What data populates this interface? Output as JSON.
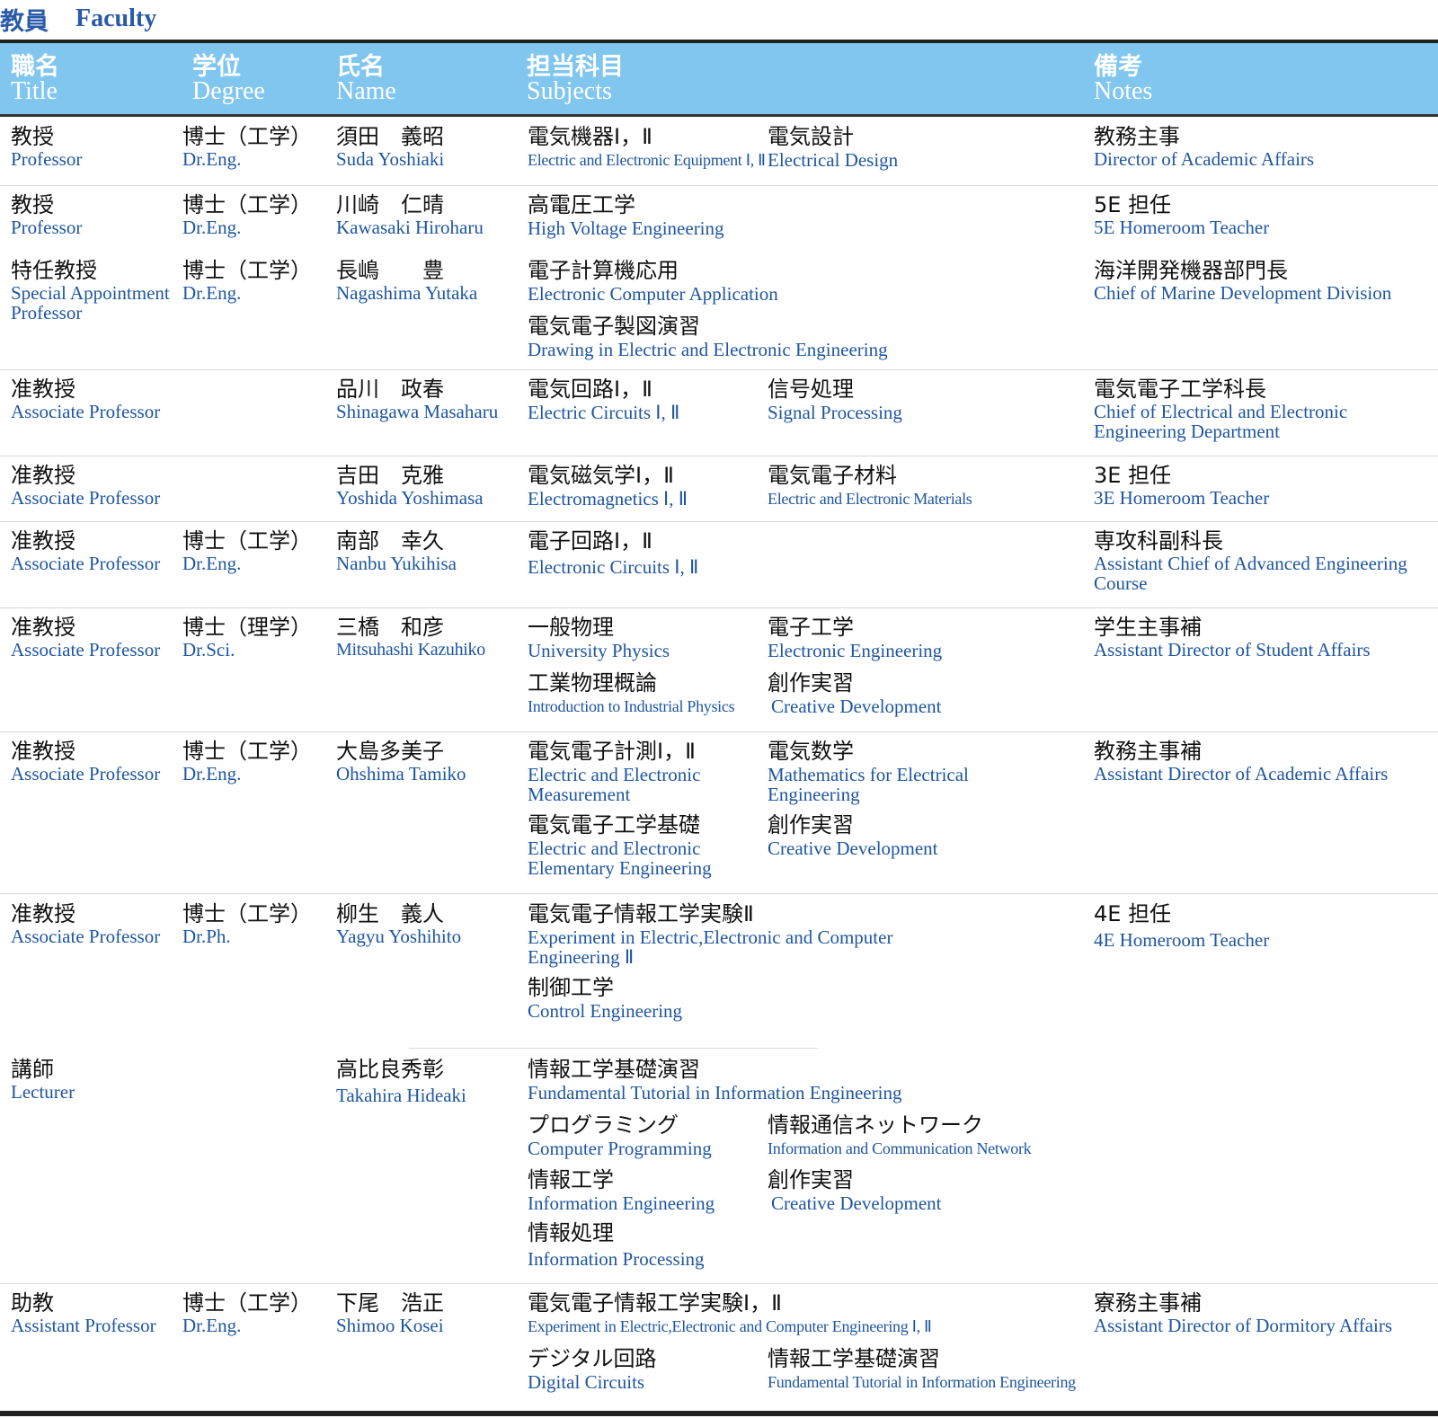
{
  "heading": {
    "ja": "教員",
    "en": "Faculty"
  },
  "columns": [
    {
      "ja": "職名",
      "en": "Title"
    },
    {
      "ja": "学位",
      "en": "Degree"
    },
    {
      "ja": "氏名",
      "en": "Name"
    },
    {
      "ja": "担当科目",
      "en": "Subjects"
    },
    {
      "ja": "備考",
      "en": "Notes"
    }
  ],
  "rows": [
    {
      "title": {
        "ja": "教授",
        "en": "Professor"
      },
      "degree": {
        "ja": "博士（工学）",
        "en": "Dr.Eng."
      },
      "name": {
        "ja": "須田　義昭",
        "en": "Suda Yoshiaki"
      },
      "subjects": [
        {
          "ja": "電気機器Ⅰ，Ⅱ",
          "en": "Electric and Electronic Equipment Ⅰ, Ⅱ"
        },
        {
          "ja": "電気設計",
          "en": "Electrical Design"
        }
      ],
      "notes": {
        "ja": "教務主事",
        "en": "Director of Academic Affairs"
      }
    },
    {
      "title": {
        "ja": "教授",
        "en": "Professor"
      },
      "degree": {
        "ja": "博士（工学）",
        "en": "Dr.Eng."
      },
      "name": {
        "ja": "川崎　仁晴",
        "en": "Kawasaki Hiroharu"
      },
      "subjects": [
        {
          "ja": "高電圧工学",
          "en": "High Voltage Engineering"
        }
      ],
      "notes": {
        "ja": "5E 担任",
        "en": "5E Homeroom Teacher"
      }
    },
    {
      "title": {
        "ja": "特任教授",
        "en": "Special Appointment Professor"
      },
      "degree": {
        "ja": "博士（工学）",
        "en": "Dr.Eng."
      },
      "name": {
        "ja": "長嶋　　豊",
        "en": "Nagashima Yutaka"
      },
      "subjects": [
        {
          "ja": "電子計算機応用",
          "en": "Electronic Computer Application"
        },
        {
          "ja": "電気電子製図演習",
          "en": "Drawing in Electric and Electronic Engineering"
        }
      ],
      "notes": {
        "ja": "海洋開発機器部門長",
        "en": "Chief of Marine Development Division"
      }
    },
    {
      "title": {
        "ja": "准教授",
        "en": "Associate Professor"
      },
      "degree": {
        "ja": "",
        "en": ""
      },
      "name": {
        "ja": "品川　政春",
        "en": "Shinagawa Masaharu"
      },
      "subjects": [
        {
          "ja": "電気回路Ⅰ，Ⅱ",
          "en": "Electric Circuits Ⅰ, Ⅱ"
        },
        {
          "ja": "信号処理",
          "en": "Signal Processing"
        }
      ],
      "notes": {
        "ja": "電気電子工学科長",
        "en": "Chief of Electrical and Electronic Engineering Department"
      }
    },
    {
      "title": {
        "ja": "准教授",
        "en": "Associate Professor"
      },
      "degree": {
        "ja": "",
        "en": ""
      },
      "name": {
        "ja": "吉田　克雅",
        "en": "Yoshida Yoshimasa"
      },
      "subjects": [
        {
          "ja": "電気磁気学Ⅰ，Ⅱ",
          "en": "Electromagnetics Ⅰ, Ⅱ"
        },
        {
          "ja": "電気電子材料",
          "en": "Electric and Electronic Materials"
        }
      ],
      "notes": {
        "ja": "3E 担任",
        "en": "3E Homeroom Teacher"
      }
    },
    {
      "title": {
        "ja": "准教授",
        "en": "Associate Professor"
      },
      "degree": {
        "ja": "博士（工学）",
        "en": "Dr.Eng."
      },
      "name": {
        "ja": "南部　幸久",
        "en": "Nanbu Yukihisa"
      },
      "subjects": [
        {
          "ja": "電子回路Ⅰ，Ⅱ",
          "en": "Electronic Circuits Ⅰ, Ⅱ"
        }
      ],
      "notes": {
        "ja": "専攻科副科長",
        "en": "Assistant Chief of Advanced Engineering Course"
      }
    },
    {
      "title": {
        "ja": "准教授",
        "en": "Associate Professor"
      },
      "degree": {
        "ja": "博士（理学）",
        "en": "Dr.Sci."
      },
      "name": {
        "ja": "三橋　和彦",
        "en": "Mitsuhashi Kazuhiko"
      },
      "subjects": [
        {
          "ja": "一般物理",
          "en": "University Physics"
        },
        {
          "ja": "電子工学",
          "en": "Electronic Engineering"
        },
        {
          "ja": "工業物理概論",
          "en": "Introduction to Industrial Physics"
        },
        {
          "ja": "創作実習",
          "en": "Creative Development"
        }
      ],
      "notes": {
        "ja": "学生主事補",
        "en": "Assistant Director of Student Affairs"
      }
    },
    {
      "title": {
        "ja": "准教授",
        "en": "Associate Professor"
      },
      "degree": {
        "ja": "博士（工学）",
        "en": "Dr.Eng."
      },
      "name": {
        "ja": "大島多美子",
        "en": "Ohshima Tamiko"
      },
      "subjects": [
        {
          "ja": "電気電子計測Ⅰ，Ⅱ",
          "en": "Electric and Electronic Measurement"
        },
        {
          "ja": "電気数学",
          "en": "Mathematics for Electrical Engineering"
        },
        {
          "ja": "電気電子工学基礎",
          "en": "Electric and Electronic Elementary Engineering"
        },
        {
          "ja": "創作実習",
          "en": "Creative Development"
        }
      ],
      "notes": {
        "ja": "教務主事補",
        "en": "Assistant Director of Academic Affairs"
      }
    },
    {
      "title": {
        "ja": "准教授",
        "en": "Associate Professor"
      },
      "degree": {
        "ja": "博士（工学）",
        "en": "Dr.Ph."
      },
      "name": {
        "ja": "柳生　義人",
        "en": "Yagyu Yoshihito"
      },
      "subjects": [
        {
          "ja": "電気電子情報工学実験Ⅱ",
          "en": "Experiment in Electric,Electronic and Computer Engineering Ⅱ"
        },
        {
          "ja": "制御工学",
          "en": "Control Engineering"
        }
      ],
      "notes": {
        "ja": "4E 担任",
        "en": "4E Homeroom Teacher"
      }
    },
    {
      "title": {
        "ja": "講師",
        "en": "Lecturer"
      },
      "degree": {
        "ja": "",
        "en": ""
      },
      "name": {
        "ja": "高比良秀彰",
        "en": "Takahira Hideaki"
      },
      "subjects": [
        {
          "ja": "情報工学基礎演習",
          "en": "Fundamental Tutorial in Information Engineering"
        },
        {
          "ja": "プログラミング",
          "en": "Computer Programming"
        },
        {
          "ja": "情報通信ネットワーク",
          "en": "Information and Communication Network"
        },
        {
          "ja": "情報工学",
          "en": "Information Engineering"
        },
        {
          "ja": "創作実習",
          "en": "Creative Development"
        },
        {
          "ja": "情報処理",
          "en": "Information Processing"
        }
      ],
      "notes": {
        "ja": "",
        "en": ""
      }
    },
    {
      "title": {
        "ja": "助教",
        "en": "Assistant Professor"
      },
      "degree": {
        "ja": "博士（工学）",
        "en": "Dr.Eng."
      },
      "name": {
        "ja": "下尾　浩正",
        "en": "Shimoo Kosei"
      },
      "subjects": [
        {
          "ja": "電気電子情報工学実験Ⅰ，Ⅱ",
          "en": "Experiment in Electric,Electronic and Computer Engineering Ⅰ, Ⅱ"
        },
        {
          "ja": "デジタル回路",
          "en": "Digital Circuits"
        },
        {
          "ja": "情報工学基礎演習",
          "en": "Fundamental Tutorial in Information Engineering"
        }
      ],
      "notes": {
        "ja": "寮務主事補",
        "en": "Assistant Director of Dormitory Affairs"
      }
    }
  ]
}
